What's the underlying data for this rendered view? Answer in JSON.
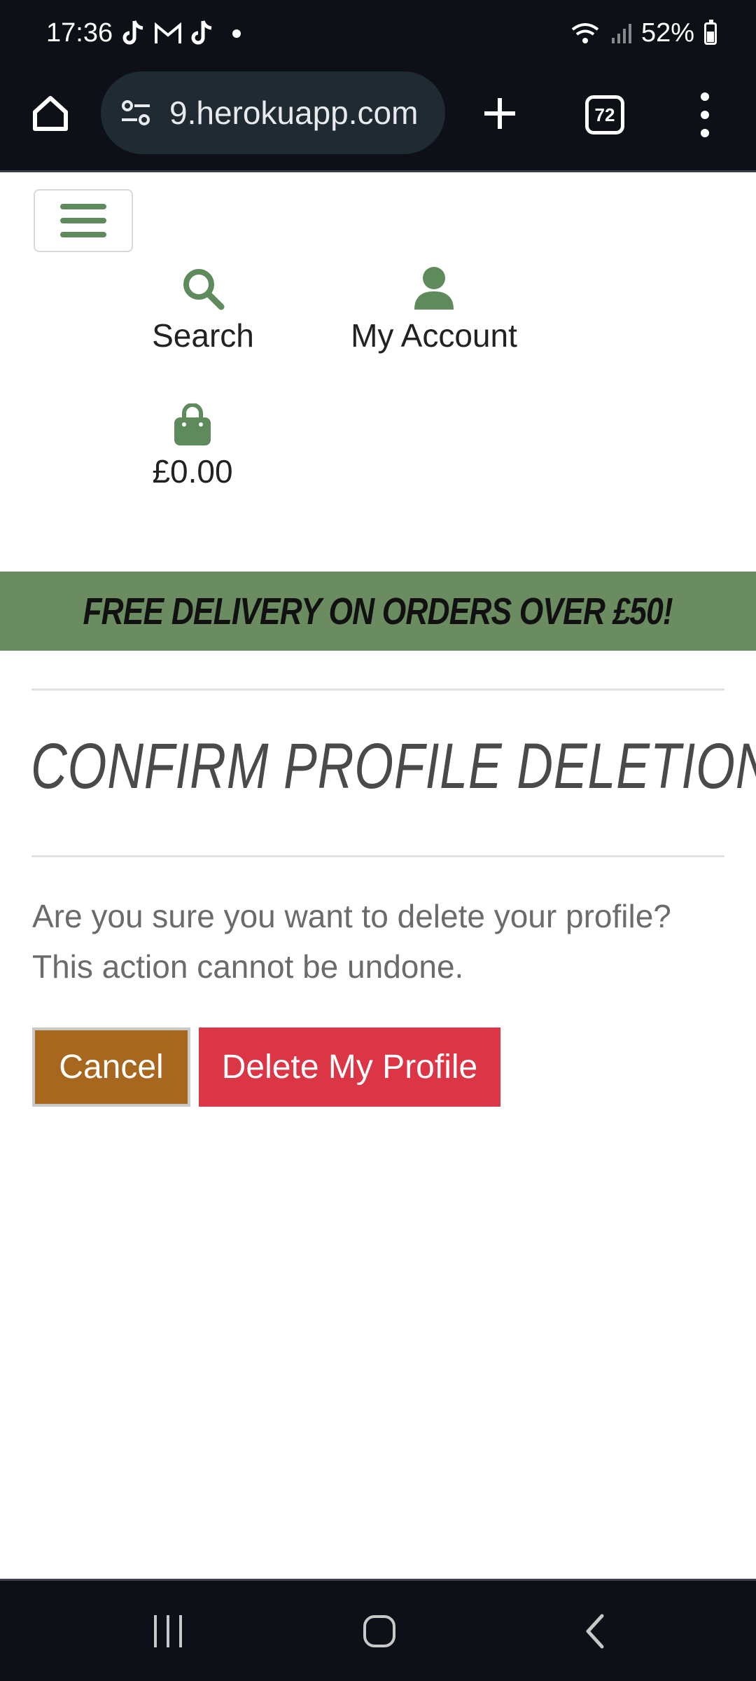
{
  "status_bar": {
    "time": "17:36",
    "battery": "52%",
    "notification_icons": [
      "tiktok-icon",
      "gmail-icon",
      "tiktok-icon",
      "dot-icon"
    ]
  },
  "browser": {
    "url": "9.herokuapp.com",
    "tab_count": "72"
  },
  "header": {
    "search_label": "Search",
    "account_label": "My Account",
    "bag_total": "£0.00",
    "accent_color": "#5f8a5c"
  },
  "banner": {
    "text": "FREE DELIVERY ON ORDERS OVER £50!",
    "background": "#6b8b60"
  },
  "main": {
    "title": "CONFIRM PROFILE DELETION",
    "message_line1": "Are you sure you want to delete your profile?",
    "message_line2": "This action cannot be undone.",
    "cancel_label": "Cancel",
    "delete_label": "Delete My Profile",
    "cancel_color": "#a8671e",
    "delete_color": "#dc3545"
  }
}
